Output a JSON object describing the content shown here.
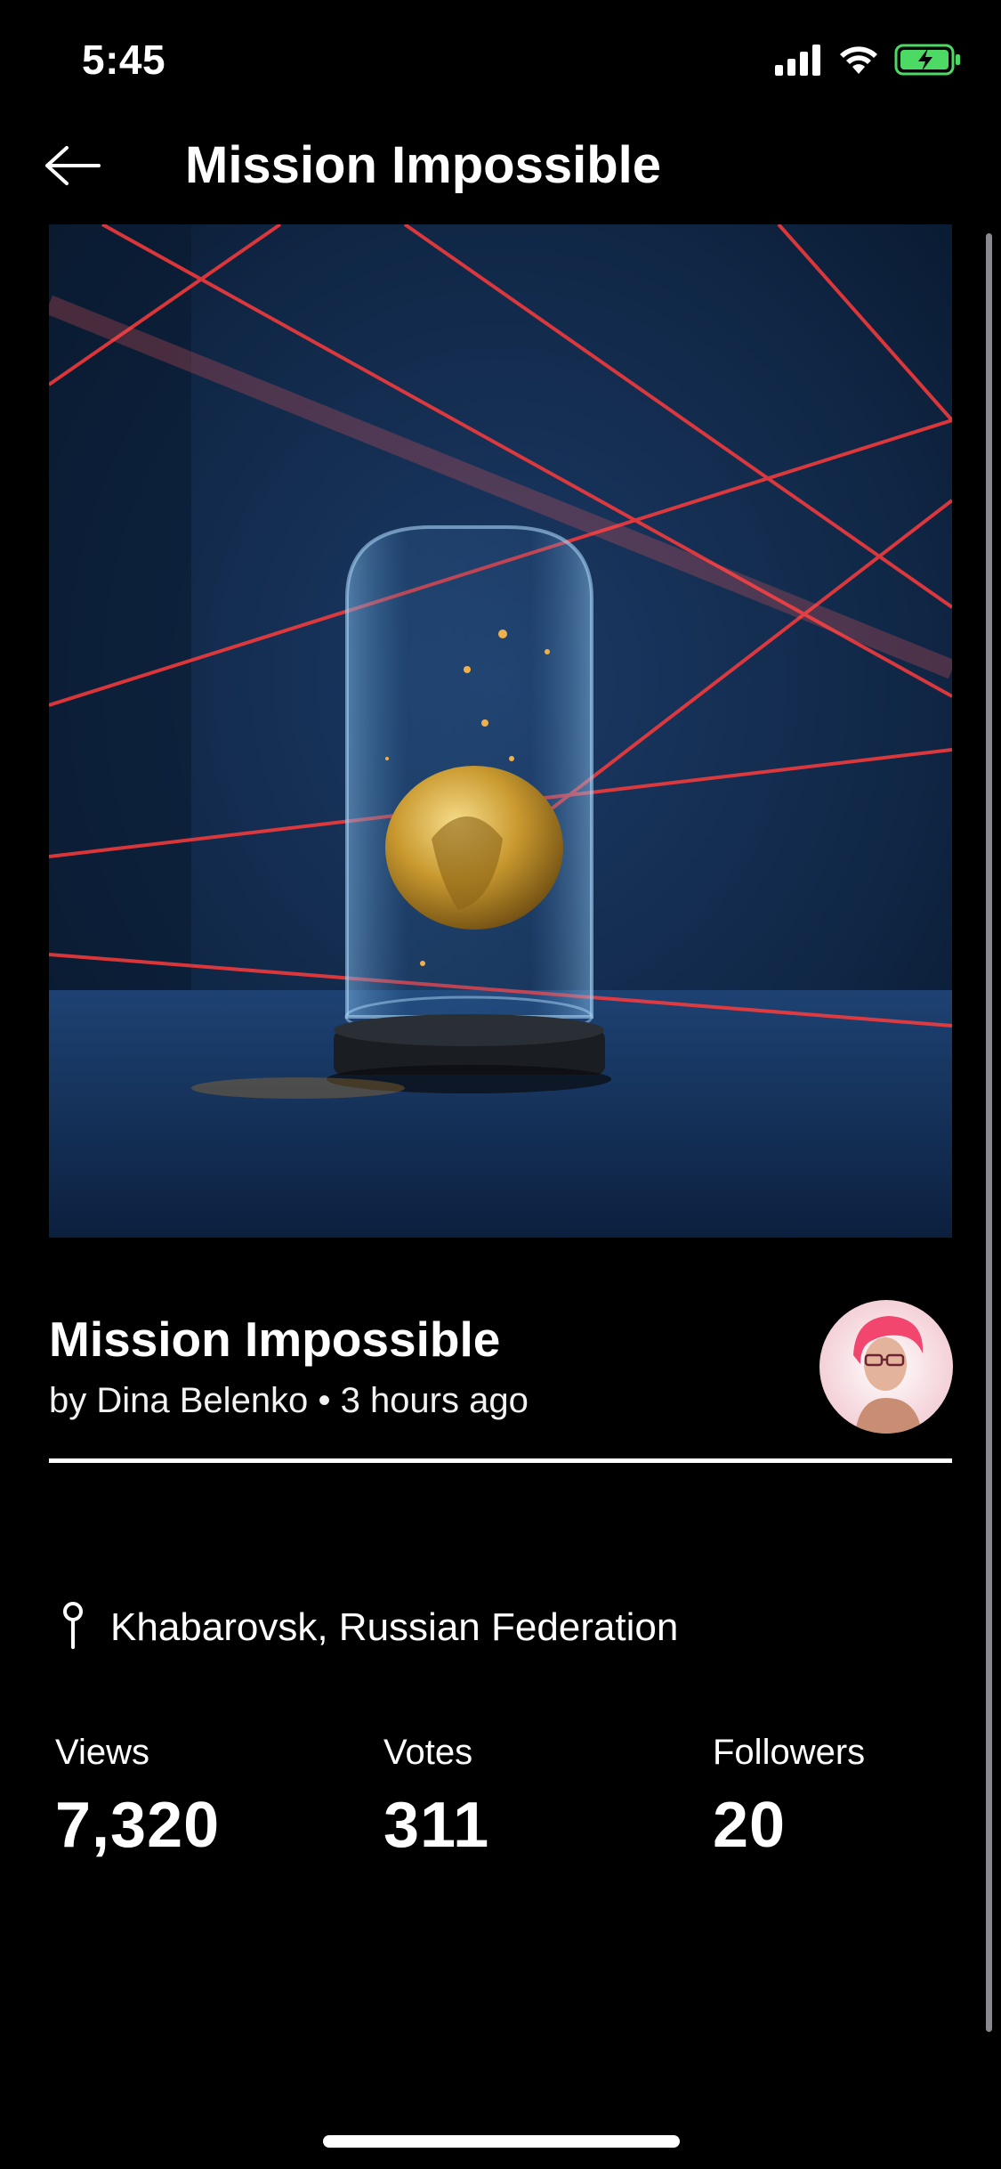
{
  "status_bar": {
    "time": "5:45"
  },
  "header": {
    "title": "Mission Impossible",
    "back_icon": "arrow-left-icon"
  },
  "photo": {
    "title": "Mission Impossible",
    "author_prefix": "by",
    "author": "Dina Belenko",
    "separator": "•",
    "time_ago": "3 hours ago",
    "watermark": "Dina Belenko"
  },
  "location": {
    "icon": "pin-icon",
    "text": "Khabarovsk, Russian Federation"
  },
  "stats": [
    {
      "label": "Views",
      "value": "7,320"
    },
    {
      "label": "Votes",
      "value": "311"
    },
    {
      "label": "Followers",
      "value": "20"
    }
  ],
  "colors": {
    "background": "#000000",
    "battery_green": "#4cd964",
    "laser_red": "#ff3b3b"
  }
}
